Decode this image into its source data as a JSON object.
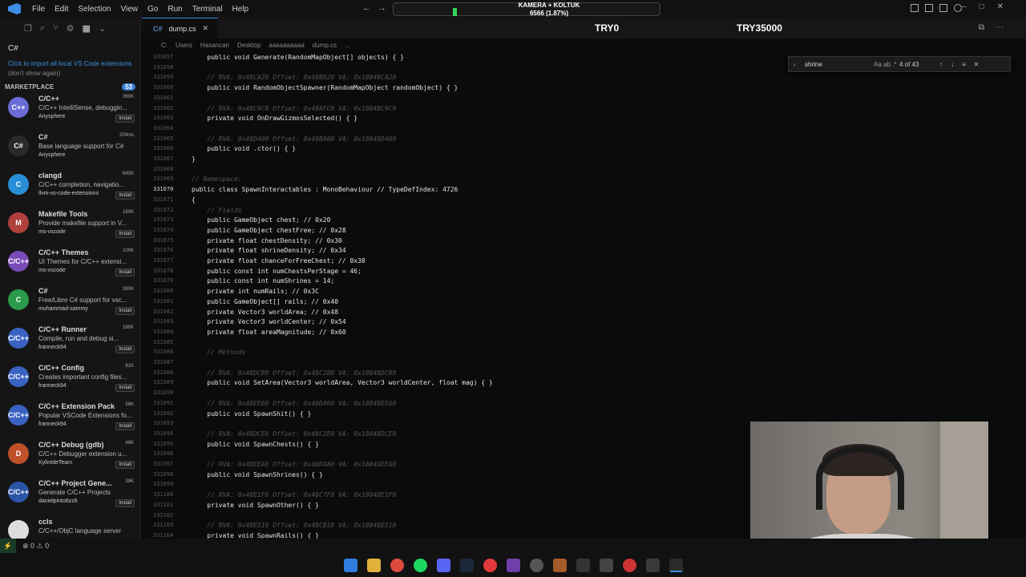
{
  "titlebar": {
    "menu": [
      "File",
      "Edit",
      "Selection",
      "View",
      "Go",
      "Run",
      "Terminal",
      "Help"
    ],
    "overlay_line1": "KAMERA + KOLTUK",
    "overlay_line2": "6566 (1.87%)"
  },
  "sidebar": {
    "search_value": "C#",
    "note_link": "Click to import all local VS Code extensions",
    "note_muted": "(don't show again)",
    "marketplace_label": "MARKETPLACE",
    "marketplace_count": "53",
    "extensions": [
      {
        "name": "C/C++",
        "desc": "C/C++ IntelliSense, debuggin...",
        "publisher": "Anysphere",
        "stat": "360K",
        "button": "Install",
        "icon_text": "C++",
        "icon_color": "#6b6bd6"
      },
      {
        "name": "C#",
        "desc": "Base language support for C#",
        "publisher": "Anysphere",
        "stat": "200ms",
        "button": "",
        "icon_text": "C#",
        "icon_color": "#2a2a2a"
      },
      {
        "name": "clangd",
        "desc": "C/C++ completion, navigatio...",
        "publisher": "llvm-vs-code-extensions",
        "stat": "640K",
        "button": "Install",
        "icon_text": "C",
        "icon_color": "#2a8ed6"
      },
      {
        "name": "Makefile Tools",
        "desc": "Provide makefile support in V...",
        "publisher": "ms-vscode",
        "stat": "180K",
        "button": "Install",
        "icon_text": "M",
        "icon_color": "#b0403c"
      },
      {
        "name": "C/C++ Themes",
        "desc": "UI Themes for C/C++ extensi...",
        "publisher": "ms-vscode",
        "stat": "100K",
        "button": "Install",
        "icon_text": "C/C++",
        "icon_color": "#7a4ab8"
      },
      {
        "name": "C#",
        "desc": "Free/Libre C# support for vsc...",
        "publisher": "muhammad-sammy",
        "stat": "380K",
        "button": "Install",
        "icon_text": "C",
        "icon_color": "#2b9a4a"
      },
      {
        "name": "C/C++ Runner",
        "desc": "Compile, run and debug si...",
        "publisher": "franneck94",
        "stat": "180K",
        "button": "Install",
        "icon_text": "C/C++",
        "icon_color": "#3a62c2"
      },
      {
        "name": "C/C++ Config",
        "desc": "Creates important config files...",
        "publisher": "franneck94",
        "stat": "81K",
        "button": "Install",
        "icon_text": "C/C++",
        "icon_color": "#3a62c2"
      },
      {
        "name": "C/C++ Extension Pack",
        "desc": "Popular VSCode Extensions fo...",
        "publisher": "franneck94",
        "stat": "58K",
        "button": "Install",
        "icon_text": "C/C++",
        "icon_color": "#3a62c2"
      },
      {
        "name": "C/C++ Debug (gdb)",
        "desc": "C/C++ Debugger extension u...",
        "publisher": "KylinIdeTeam",
        "stat": "48K",
        "button": "Install",
        "icon_text": "D",
        "icon_color": "#c0502a"
      },
      {
        "name": "C/C++ Project Gene...",
        "desc": "Generate C/C++ Projects",
        "publisher": "danielpinto8zz6",
        "stat": "39K",
        "button": "Install",
        "icon_text": "C/C++",
        "icon_color": "#2c54a8"
      },
      {
        "name": "ccls",
        "desc": "C/C++/ObjC language server",
        "publisher": "",
        "stat": "",
        "button": "",
        "icon_text": "",
        "icon_color": "#ddd"
      }
    ]
  },
  "tabs": {
    "active_tab": "dump.cs",
    "overlay_try0": "TRY0",
    "overlay_try1": "TRY35000"
  },
  "breadcrumb": [
    "C:",
    "Users",
    "Hasancan",
    "Desktop",
    "aaaaaaaaaa",
    "dump.cs",
    "..."
  ],
  "find": {
    "query": "shrine",
    "options": "Aa ab .*",
    "count": "4 of 43"
  },
  "code_lines": [
    {
      "n": "331057",
      "t": "    public void Generate(RandomMapObject[] objects) { }",
      "c": false
    },
    {
      "n": "331058",
      "t": "",
      "c": false
    },
    {
      "n": "331059",
      "t": "    // RVA: 0x48CA20 Offset: 0x48B020 VA: 0x18048CA20",
      "c": true
    },
    {
      "n": "331060",
      "t": "    public void RandomObjectSpawner(RandomMapObject randomObject) { }",
      "c": false
    },
    {
      "n": "331061",
      "t": "",
      "c": false
    },
    {
      "n": "331062",
      "t": "    // RVA: 0x48C9C0 Offset: 0x48AFC0 VA: 0x18048C9C0",
      "c": true
    },
    {
      "n": "331063",
      "t": "    private void OnDrawGizmosSelected() { }",
      "c": false
    },
    {
      "n": "331064",
      "t": "",
      "c": false
    },
    {
      "n": "331065",
      "t": "    // RVA: 0x48D400 Offset: 0x48BA00 VA: 0x18048D400",
      "c": true
    },
    {
      "n": "331066",
      "t": "    public void .ctor() { }",
      "c": false
    },
    {
      "n": "331067",
      "t": "}",
      "c": false
    },
    {
      "n": "331068",
      "t": "",
      "c": false
    },
    {
      "n": "331069",
      "t": "// Namespace:",
      "c": true
    },
    {
      "n": "331070",
      "t": "public class SpawnInteractables : MonoBehaviour // TypeDefIndex: 4726",
      "c": false,
      "active": true
    },
    {
      "n": "331071",
      "t": "{",
      "c": false
    },
    {
      "n": "331072",
      "t": "    // Fields",
      "c": true
    },
    {
      "n": "331073",
      "t": "    public GameObject chest; // 0x20",
      "c": false
    },
    {
      "n": "331074",
      "t": "    public GameObject chestFree; // 0x28",
      "c": false
    },
    {
      "n": "331075",
      "t": "    private float chestDensity; // 0x30",
      "c": false
    },
    {
      "n": "331076",
      "t": "    private float shrineDensity; // 0x34",
      "c": false
    },
    {
      "n": "331077",
      "t": "    private float chanceForFreeChest; // 0x38",
      "c": false
    },
    {
      "n": "331078",
      "t": "    public const int numChestsPerStage = 46;",
      "c": false
    },
    {
      "n": "331079",
      "t": "    public const int numShrines = 14;",
      "c": false
    },
    {
      "n": "331080",
      "t": "    private int numRails; // 0x3C",
      "c": false
    },
    {
      "n": "331081",
      "t": "    public GameObject[] rails; // 0x40",
      "c": false
    },
    {
      "n": "331082",
      "t": "    private Vector3 worldArea; // 0x48",
      "c": false
    },
    {
      "n": "331083",
      "t": "    private Vector3 worldCenter; // 0x54",
      "c": false
    },
    {
      "n": "331084",
      "t": "    private float areaMagnitude; // 0x60",
      "c": false
    },
    {
      "n": "331085",
      "t": "",
      "c": false
    },
    {
      "n": "331086",
      "t": "    // Methods",
      "c": true
    },
    {
      "n": "331087",
      "t": "",
      "c": false
    },
    {
      "n": "331088",
      "t": "    // RVA: 0x48DCB0 Offset: 0x48C2B0 VA: 0x18048DCB0",
      "c": true
    },
    {
      "n": "331089",
      "t": "    public void SetArea(Vector3 worldArea, Vector3 worldCenter, float mag) { }",
      "c": false
    },
    {
      "n": "331090",
      "t": "",
      "c": false
    },
    {
      "n": "331091",
      "t": "    // RVA: 0x48EE60 Offset: 0x48D460 VA: 0x18048EE60",
      "c": true
    },
    {
      "n": "331092",
      "t": "    public void SpawnShit() { }",
      "c": false
    },
    {
      "n": "331093",
      "t": "",
      "c": false
    },
    {
      "n": "331094",
      "t": "    // RVA: 0x48DCE0 Offset: 0x48C2E0 VA: 0x18048DCE0",
      "c": true
    },
    {
      "n": "331095",
      "t": "    public void SpawnChests() { }",
      "c": false
    },
    {
      "n": "331096",
      "t": "",
      "c": false
    },
    {
      "n": "331097",
      "t": "    // RVA: 0x48EEA0 Offset: 0x48D4A0 VA: 0x18048EEA0",
      "c": true
    },
    {
      "n": "331098",
      "t": "    public void SpawnShrines() { }",
      "c": false
    },
    {
      "n": "331099",
      "t": "",
      "c": false
    },
    {
      "n": "331100",
      "t": "    // RVA: 0x48E1F0 Offset: 0x48C7F0 VA: 0x18048E1F0",
      "c": true
    },
    {
      "n": "331101",
      "t": "    private void SpawnOther() { }",
      "c": false
    },
    {
      "n": "331102",
      "t": "",
      "c": false
    },
    {
      "n": "331103",
      "t": "    // RVA: 0x48E510 Offset: 0x48CB10 VA: 0x18048E510",
      "c": true
    },
    {
      "n": "331104",
      "t": "    private void SpawnRails() { }",
      "c": false
    }
  ],
  "statusbar": {
    "problems": "⊗ 0  ⚠ 0"
  },
  "colors": {
    "accent": "#3c8ee6",
    "editor_bg": "#0b0b0b",
    "sidebar_bg": "#151515",
    "link": "#3b8edb"
  }
}
